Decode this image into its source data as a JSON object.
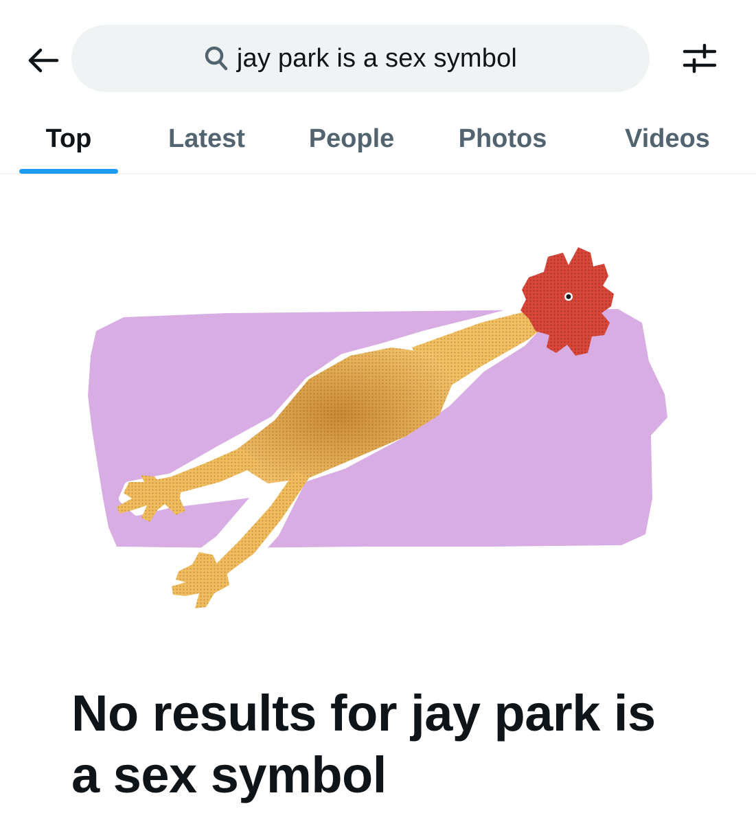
{
  "search": {
    "query": "jay park is a sex symbol"
  },
  "tabs": [
    {
      "label": "Top",
      "active": true
    },
    {
      "label": "Latest",
      "active": false
    },
    {
      "label": "People",
      "active": false
    },
    {
      "label": "Photos",
      "active": false
    },
    {
      "label": "Videos",
      "active": false
    }
  ],
  "empty_state": {
    "message": "No results for jay park is a sex symbol"
  },
  "icons": {
    "back": "arrow-left-icon",
    "search": "search-icon",
    "filter": "sliders-icon"
  },
  "colors": {
    "accent": "#1d9bf0",
    "text_primary": "#0f1419",
    "text_secondary": "#536471",
    "search_bg": "#eff3f4",
    "illustration_bg": "#d8ade3",
    "chicken_body": "#eab55a",
    "chicken_comb": "#d9473a"
  }
}
